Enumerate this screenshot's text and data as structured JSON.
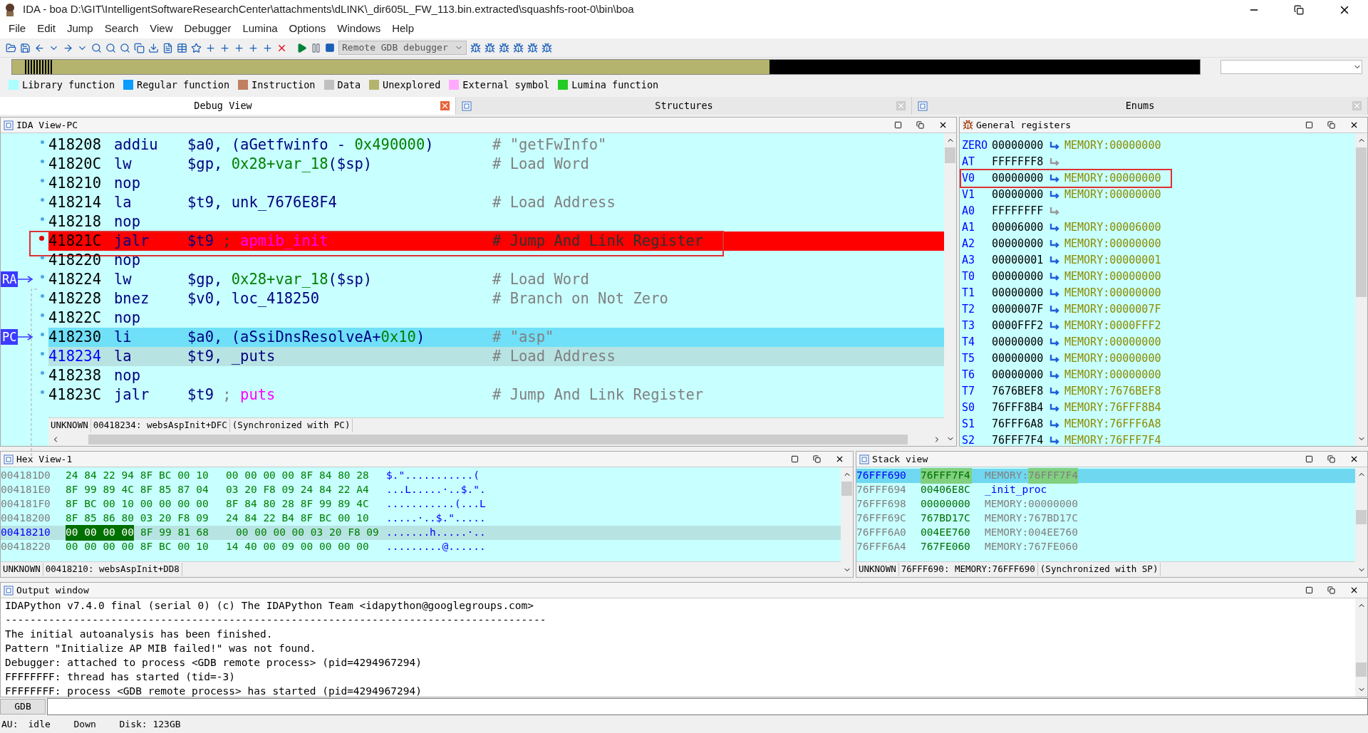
{
  "window": {
    "title": "IDA - boa D:\\GIT\\IntelligentSoftwareResearchCenter\\attachments\\dLINK\\_dir605L_FW_113.bin.extracted\\squashfs-root-0\\bin\\boa"
  },
  "menu": [
    "File",
    "Edit",
    "Jump",
    "Search",
    "View",
    "Debugger",
    "Lumina",
    "Options",
    "Windows",
    "Help"
  ],
  "toolbar": {
    "debugger_select": "Remote GDB debugger"
  },
  "legend": [
    {
      "label": "Library function",
      "color": "#aaffff"
    },
    {
      "label": "Regular function",
      "color": "#0a9cff"
    },
    {
      "label": "Instruction",
      "color": "#c08060"
    },
    {
      "label": "Data",
      "color": "#c0c0c0"
    },
    {
      "label": "Unexplored",
      "color": "#b4b46e"
    },
    {
      "label": "External symbol",
      "color": "#ffaaff"
    },
    {
      "label": "Lumina function",
      "color": "#22cc22"
    }
  ],
  "tabs": [
    {
      "label": "Debug View",
      "selected": true
    },
    {
      "label": "Structures",
      "selected": false
    },
    {
      "label": "Enums",
      "selected": false
    }
  ],
  "ida_view": {
    "title": "IDA View-PC",
    "lines": [
      {
        "address": "418208",
        "mnemonic": "addiu",
        "operands": [
          {
            "text": "$a0",
            "kind": "reg"
          },
          {
            "text": ", (",
            "kind": "punct"
          },
          {
            "text": "aGetfwinfo - ",
            "kind": "name"
          },
          {
            "text": "0x490000",
            "kind": "num"
          },
          {
            "text": ")",
            "kind": "punct"
          }
        ],
        "comment": "# \"getFwInfo\"",
        "kind": "normal",
        "selected": false
      },
      {
        "address": "41820C",
        "mnemonic": "lw",
        "operands": [
          {
            "text": "$gp",
            "kind": "reg"
          },
          {
            "text": ", ",
            "kind": "punct"
          },
          {
            "text": "0x28+var_18",
            "kind": "num"
          },
          {
            "text": "($sp)",
            "kind": "reg"
          }
        ],
        "comment": "# Load Word",
        "kind": "normal",
        "selected": false
      },
      {
        "address": "418210",
        "mnemonic": "nop",
        "kind": "normal",
        "selected": false
      },
      {
        "address": "418214",
        "mnemonic": "la",
        "operands": [
          {
            "text": "$t9",
            "kind": "reg"
          },
          {
            "text": ", ",
            "kind": "punct"
          },
          {
            "text": "unk_7676E8F4",
            "kind": "name"
          }
        ],
        "comment": "# Load Address",
        "kind": "normal",
        "selected": false
      },
      {
        "address": "418218",
        "mnemonic": "nop",
        "kind": "normal",
        "selected": false
      },
      {
        "address": "41821C",
        "mnemonic": "jalr",
        "operands": [
          {
            "text": "$t9",
            "kind": "reg"
          },
          {
            "text": " ; ",
            "kind": "cmt"
          },
          {
            "text": "apmib_init",
            "kind": "sym"
          }
        ],
        "comment": "# Jump And Link Register",
        "kind": "breakpoint",
        "selected": false,
        "annotated": true
      },
      {
        "address": "418220",
        "mnemonic": "nop",
        "kind": "normal",
        "selected": false
      },
      {
        "address": "418224",
        "mnemonic": "lw",
        "operands": [
          {
            "text": "$gp",
            "kind": "reg"
          },
          {
            "text": ", ",
            "kind": "punct"
          },
          {
            "text": "0x28+var_18",
            "kind": "num"
          },
          {
            "text": "($sp)",
            "kind": "reg"
          }
        ],
        "comment": "# Load Word",
        "kind": "normal",
        "selected": false,
        "pointer": "RA"
      },
      {
        "address": "418228",
        "mnemonic": "bnez",
        "operands": [
          {
            "text": "$v0",
            "kind": "reg"
          },
          {
            "text": ", ",
            "kind": "punct"
          },
          {
            "text": "loc_418250",
            "kind": "name"
          }
        ],
        "comment": "# Branch on Not Zero",
        "kind": "normal",
        "selected": false
      },
      {
        "address": "41822C",
        "mnemonic": "nop",
        "kind": "normal",
        "selected": false
      },
      {
        "address": "418230",
        "mnemonic": "li",
        "operands": [
          {
            "text": "$a0",
            "kind": "reg"
          },
          {
            "text": ", (",
            "kind": "punct"
          },
          {
            "text": "aSsiDnsResolveA+",
            "kind": "name"
          },
          {
            "text": "0x10",
            "kind": "num"
          },
          {
            "text": ")",
            "kind": "punct"
          }
        ],
        "comment": "# \"asp\"",
        "kind": "current",
        "selected": false,
        "pointer": "PC"
      },
      {
        "address": "418234",
        "mnemonic": "la",
        "operands": [
          {
            "text": "$t9",
            "kind": "reg"
          },
          {
            "text": ", ",
            "kind": "punct"
          },
          {
            "text": "_puts",
            "kind": "name"
          }
        ],
        "comment": "# Load Address",
        "kind": "normal",
        "selected": true
      },
      {
        "address": "418238",
        "mnemonic": "nop",
        "kind": "normal",
        "selected": false
      },
      {
        "address": "41823C",
        "mnemonic": "jalr",
        "operands": [
          {
            "text": "$t9",
            "kind": "reg"
          },
          {
            "text": " ; ",
            "kind": "cmt"
          },
          {
            "text": "puts",
            "kind": "sym"
          }
        ],
        "comment": "# Jump And Link Register",
        "kind": "normal",
        "selected": false
      }
    ],
    "status": [
      "UNKNOWN",
      "00418234: websAspInit+DFC",
      "(Synchronized with PC)"
    ]
  },
  "registers": {
    "title": "General registers",
    "rows": [
      {
        "name": "ZERO",
        "value": "00000000",
        "memory": "MEMORY:00000000"
      },
      {
        "name": "AT",
        "value": "FFFFFFF8"
      },
      {
        "name": "V0",
        "value": "00000000",
        "memory": "MEMORY:00000000",
        "annotated": true
      },
      {
        "name": "V1",
        "value": "00000000",
        "memory": "MEMORY:00000000"
      },
      {
        "name": "A0",
        "value": "FFFFFFFF"
      },
      {
        "name": "A1",
        "value": "00006000",
        "memory": "MEMORY:00006000"
      },
      {
        "name": "A2",
        "value": "00000000",
        "memory": "MEMORY:00000000"
      },
      {
        "name": "A3",
        "value": "00000001",
        "memory": "MEMORY:00000001"
      },
      {
        "name": "T0",
        "value": "00000000",
        "memory": "MEMORY:00000000"
      },
      {
        "name": "T1",
        "value": "00000000",
        "memory": "MEMORY:00000000"
      },
      {
        "name": "T2",
        "value": "0000007F",
        "memory": "MEMORY:0000007F"
      },
      {
        "name": "T3",
        "value": "0000FFF2",
        "memory": "MEMORY:0000FFF2"
      },
      {
        "name": "T4",
        "value": "00000000",
        "memory": "MEMORY:00000000"
      },
      {
        "name": "T5",
        "value": "00000000",
        "memory": "MEMORY:00000000"
      },
      {
        "name": "T6",
        "value": "00000000",
        "memory": "MEMORY:00000000"
      },
      {
        "name": "T7",
        "value": "7676BEF8",
        "memory": "MEMORY:7676BEF8"
      },
      {
        "name": "S0",
        "value": "76FFF8B4",
        "memory": "MEMORY:76FFF8B4"
      },
      {
        "name": "S1",
        "value": "76FFF6A8",
        "memory": "MEMORY:76FFF6A8"
      },
      {
        "name": "S2",
        "value": "76FFF7F4",
        "memory": "MEMORY:76FFF7F4"
      }
    ]
  },
  "hex_view": {
    "title": "Hex View-1",
    "rows": [
      {
        "address": "004181D0",
        "bytes": [
          "24 84 22 94 8F BC 00 10",
          "00 00 00 00 8F 84 80 28"
        ],
        "ascii": "$.\"...........(",
        "selected": false
      },
      {
        "address": "004181E0",
        "bytes": [
          "8F 99 89 4C 8F 85 87 04",
          "03 20 F8 09 24 84 22 A4"
        ],
        "ascii": "...L.....·..$.\".",
        "selected": false
      },
      {
        "address": "004181F0",
        "bytes": [
          "8F BC 00 10 00 00 00 00",
          "8F 84 80 28 8F 99 89 4C"
        ],
        "ascii": "...........(...L",
        "selected": false
      },
      {
        "address": "00418200",
        "bytes": [
          "8F 85 86 80 03 20 F8 09",
          "24 84 22 B4 8F BC 00 10"
        ],
        "ascii": ".....·..$.\".....",
        "selected": false
      },
      {
        "address": "00418210",
        "cursor": "00 00 00 00",
        "bytes": [
          "8F 99 81 68",
          "00 00 00 00 03 20 F8 09"
        ],
        "ascii": ".......h.....·..",
        "selected": true
      },
      {
        "address": "00418220",
        "bytes": [
          "00 00 00 00 8F BC 00 10",
          "14 40 00 09 00 00 00 00"
        ],
        "ascii": ".........@......",
        "selected": false
      }
    ],
    "status": [
      "UNKNOWN",
      "00418210: websAspInit+DD8"
    ]
  },
  "stack_view": {
    "title": "Stack view",
    "rows": [
      {
        "address": "76FFF690",
        "value": "76FFF7F4",
        "kind": "memory",
        "label": "MEMORY:",
        "target": "76FFF7F4",
        "selected": true
      },
      {
        "address": "76FFF694",
        "value": "00406E8C",
        "kind": "symbol",
        "label": "_init_proc",
        "selected": false
      },
      {
        "address": "76FFF698",
        "value": "00000000",
        "kind": "memory",
        "label": "MEMORY:",
        "target": "00000000",
        "selected": false
      },
      {
        "address": "76FFF69C",
        "value": "767BD17C",
        "kind": "memory",
        "label": "MEMORY:",
        "target": "767BD17C",
        "selected": false
      },
      {
        "address": "76FFF6A0",
        "value": "004EE760",
        "kind": "memory",
        "label": "MEMORY:",
        "target": "004EE760",
        "selected": false
      },
      {
        "address": "76FFF6A4",
        "value": "767FE060",
        "kind": "memory",
        "label": "MEMORY:",
        "target": "767FE060",
        "selected": false
      }
    ],
    "status": [
      "UNKNOWN",
      "76FFF690: MEMORY:76FFF690",
      "(Synchronized with SP)"
    ]
  },
  "output": {
    "title": "Output window",
    "lines": [
      "IDAPython v7.4.0 final (serial 0) (c) The IDAPython Team <idapython@googlegroups.com>",
      "---------------------------------------------------------------------------------------",
      "The initial autoanalysis has been finished.",
      "Pattern \"Initialize AP MIB failed!\" was not found.",
      "Debugger: attached to process <GDB remote process> (pid=4294967294)",
      "FFFFFFFF: thread has started (tid=-3)",
      "FFFFFFFF: process <GDB remote process> has started (pid=4294967294)"
    ],
    "command_button": "GDB"
  },
  "status_bar": {
    "au_label": "AU:",
    "au_state": "idle",
    "direction": "Down",
    "disk": "Disk: 123GB"
  }
}
